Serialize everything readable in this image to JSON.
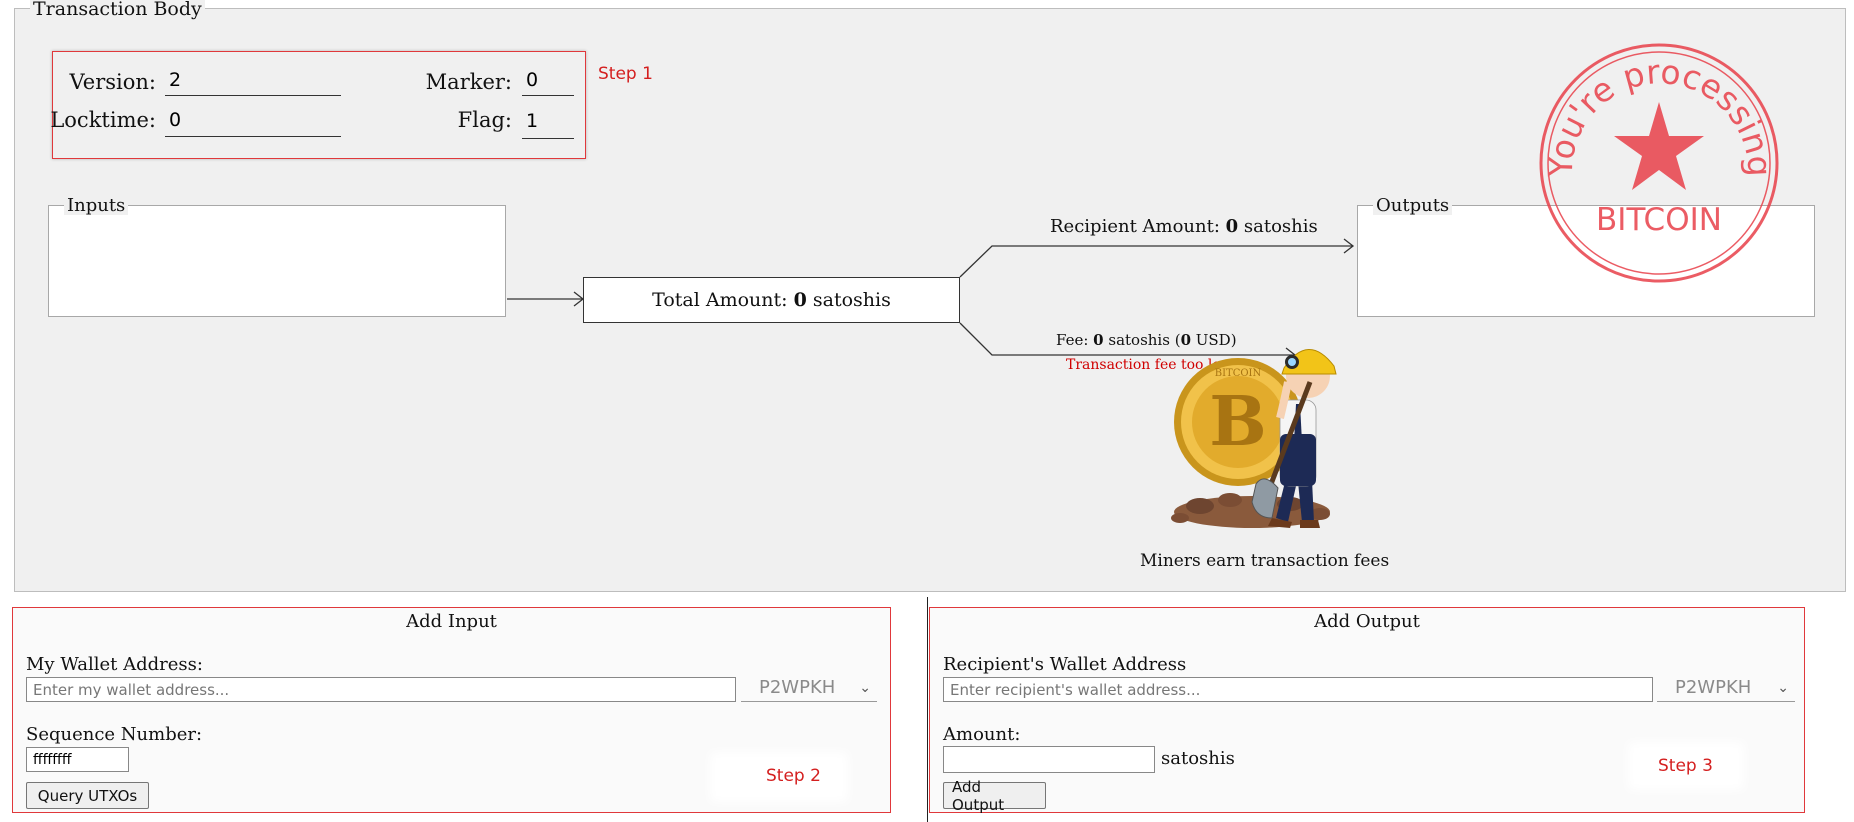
{
  "transaction_body": {
    "legend": "Transaction Body",
    "step1": {
      "label": "Step 1",
      "version_label": "Version:",
      "version_value": "2",
      "locktime_label": "Locktime:",
      "locktime_value": "0",
      "marker_label": "Marker:",
      "marker_value": "0",
      "flag_label": "Flag:",
      "flag_value": "1"
    },
    "inputs_legend": "Inputs",
    "outputs_legend": "Outputs",
    "total_amount": {
      "prefix": "Total Amount: ",
      "value": "0",
      "suffix": " satoshis"
    },
    "recipient_amount": {
      "prefix": "Recipient Amount: ",
      "value": "0",
      "suffix": " satoshis"
    },
    "fee": {
      "prefix": "Fee: ",
      "value": "0",
      "middle": " satoshis (",
      "usd": "0",
      "suffix": " USD)"
    },
    "fee_warning": "Transaction fee too low",
    "miner_caption": "Miners earn transaction fees",
    "stamp": {
      "top_text": "You're processing",
      "bottom_text": "BITCOIN",
      "color": "#e8404a"
    },
    "coin_letter": "B",
    "coin_text": "BITCOIN"
  },
  "add_input": {
    "title": "Add Input",
    "wallet_label": "My Wallet Address:",
    "wallet_placeholder": "Enter my wallet address...",
    "wallet_value": "",
    "script_type": "P2WPKH",
    "sequence_label": "Sequence Number:",
    "sequence_value": "ffffffff",
    "query_button": "Query UTXOs",
    "step_label": "Step 2"
  },
  "add_output": {
    "title": "Add Output",
    "wallet_label": "Recipient's Wallet Address",
    "wallet_placeholder": "Enter recipient's wallet address...",
    "wallet_value": "",
    "script_type": "P2WPKH",
    "amount_label": "Amount:",
    "amount_value": "",
    "amount_unit": "satoshis",
    "add_button": "Add Output",
    "step_label": "Step 3"
  },
  "colors": {
    "accent_red": "#e0383b",
    "body_bg": "#f0f0f0",
    "warning_red": "#d00000"
  }
}
